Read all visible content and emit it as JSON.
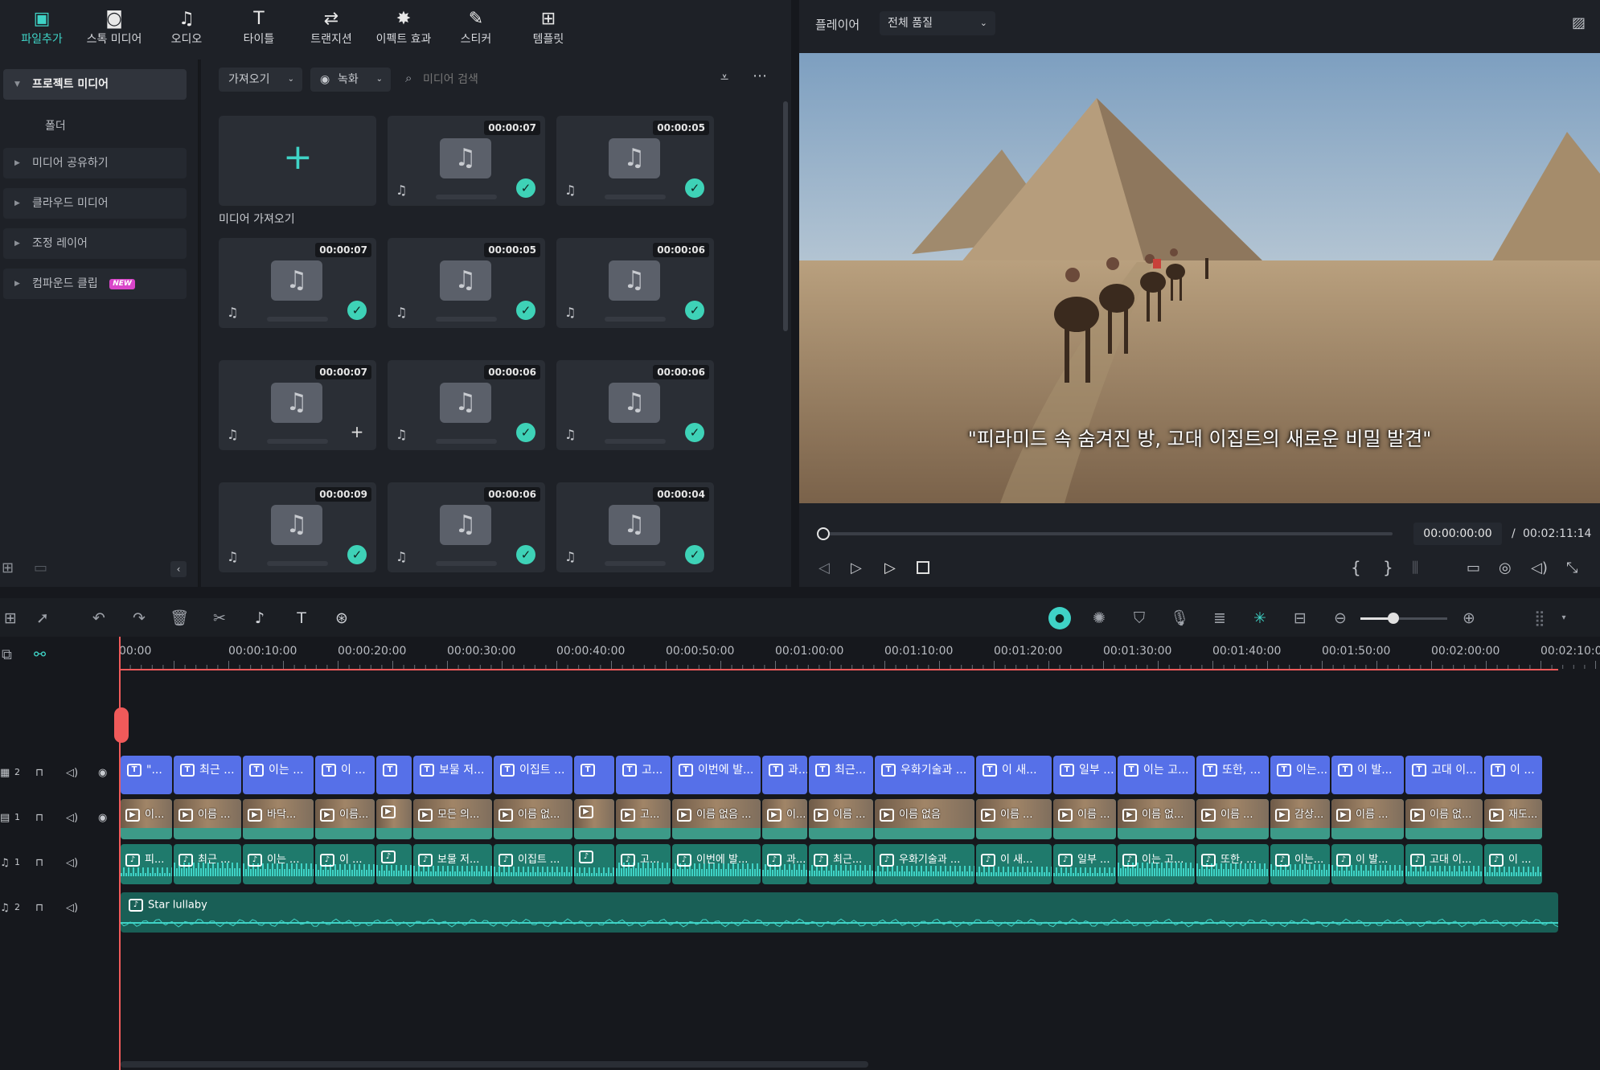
{
  "top_tabs": [
    {
      "label": "파일추가",
      "icon": "import-media-icon",
      "glyph": "▣",
      "active": true
    },
    {
      "label": "스톡 미디어",
      "icon": "stock-media-icon",
      "glyph": "◙",
      "active": false
    },
    {
      "label": "오디오",
      "icon": "music-note-icon",
      "glyph": "♫",
      "active": false
    },
    {
      "label": "타이틀",
      "icon": "title-text-icon",
      "glyph": "T",
      "active": false
    },
    {
      "label": "트랜지션",
      "icon": "transition-icon",
      "glyph": "⇄",
      "active": false
    },
    {
      "label": "이펙트 효과",
      "icon": "effects-sparkle-icon",
      "glyph": "✸",
      "active": false
    },
    {
      "label": "스티커",
      "icon": "sticker-icon",
      "glyph": "✎",
      "active": false
    },
    {
      "label": "템플릿",
      "icon": "template-icon",
      "glyph": "⊞",
      "active": false
    }
  ],
  "left_panel": {
    "items": [
      {
        "label": "프로젝트 미디어",
        "selected": true
      },
      {
        "label": "미디어 공유하기"
      },
      {
        "label": "클라우드 미디어"
      },
      {
        "label": "조정 레이어"
      },
      {
        "label": "컴파운드 클립"
      }
    ],
    "folder_label": "폴더",
    "new_badge": "NEW"
  },
  "media_toolbar": {
    "import_dropdown": "가져오기",
    "record_dropdown": "녹화",
    "search_placeholder": "미디어 검색"
  },
  "media_grid": {
    "import_label": "미디어 가져오기",
    "cards": [
      {
        "duration": "00:00:07",
        "status": "check"
      },
      {
        "duration": "00:00:05",
        "status": "check"
      },
      {
        "duration": "00:00:07",
        "status": "check"
      },
      {
        "duration": "00:00:05",
        "status": "check"
      },
      {
        "duration": "00:00:06",
        "status": "check"
      },
      {
        "duration": "00:00:07",
        "status": "plus"
      },
      {
        "duration": "00:00:06",
        "status": "check"
      },
      {
        "duration": "00:00:06",
        "status": "check"
      },
      {
        "duration": "00:00:09",
        "status": "check"
      },
      {
        "duration": "00:00:06",
        "status": "check"
      },
      {
        "duration": "00:00:04",
        "status": "check"
      }
    ]
  },
  "player": {
    "label": "플레이어",
    "quality": "전체 품질",
    "subtitle": "\"피라미드 속 숨겨진 방, 고대 이집트의 새로운 비밀 발견\"",
    "current_time": "00:00:00:00",
    "separator": "/",
    "total_time": "00:02:11:14"
  },
  "ruler": [
    "00:00",
    "00:00:10:00",
    "00:00:20:00",
    "00:00:30:00",
    "00:00:40:00",
    "00:00:50:00",
    "00:01:00:00",
    "00:01:10:00",
    "00:01:20:00",
    "00:01:30:00",
    "00:01:40:00",
    "00:01:50:00",
    "00:02:00:00",
    "00:02:10:00"
  ],
  "tracks": {
    "title_track": "2",
    "video_track": "1",
    "audio1_track": "1",
    "audio2_track": "2"
  },
  "title_clips": [
    "\"...",
    "최근 ...",
    "이는 ...",
    "이 ...",
    "",
    "보물 저...",
    "이집트 ...",
    "",
    "고...",
    "이번에 발...",
    "과...",
    "최근...",
    "우화기술과 ...",
    "이 새...",
    "일부 ...",
    "이는 고...",
    "또한, ...",
    "이는...",
    "이 발...",
    "고대 이...",
    "이 ..."
  ],
  "video_clips": [
    "이...",
    "이름 ...",
    "바닥...",
    "이름...",
    "",
    "모든 의...",
    "이름 없...",
    "",
    "고...",
    "이름 없음 ...",
    "이...",
    "이름 ...",
    "이름 없음",
    "이름 ...",
    "이름 ...",
    "이름 없...",
    "이름 ...",
    "감상...",
    "이름 ...",
    "이름 없...",
    "재도..."
  ],
  "audio_clips": [
    "피...",
    "최근 ...",
    "이는 ...",
    "이 ...",
    "",
    "보물 저...",
    "이집트 ...",
    "",
    "고...",
    "이번에 발...",
    "과...",
    "최근...",
    "우화기술과 ...",
    "이 새...",
    "일부 ...",
    "이는 고...",
    "또한, ...",
    "이는...",
    "이 발...",
    "고대 이...",
    "이 ..."
  ],
  "music_clip": "Star lullaby",
  "colors": {
    "accent": "#3fd3c6",
    "title_clip": "#5670e8",
    "video_clip": "#3d9a88",
    "audio_clip": "#1f7a6c",
    "playhead": "#f05a5a"
  }
}
